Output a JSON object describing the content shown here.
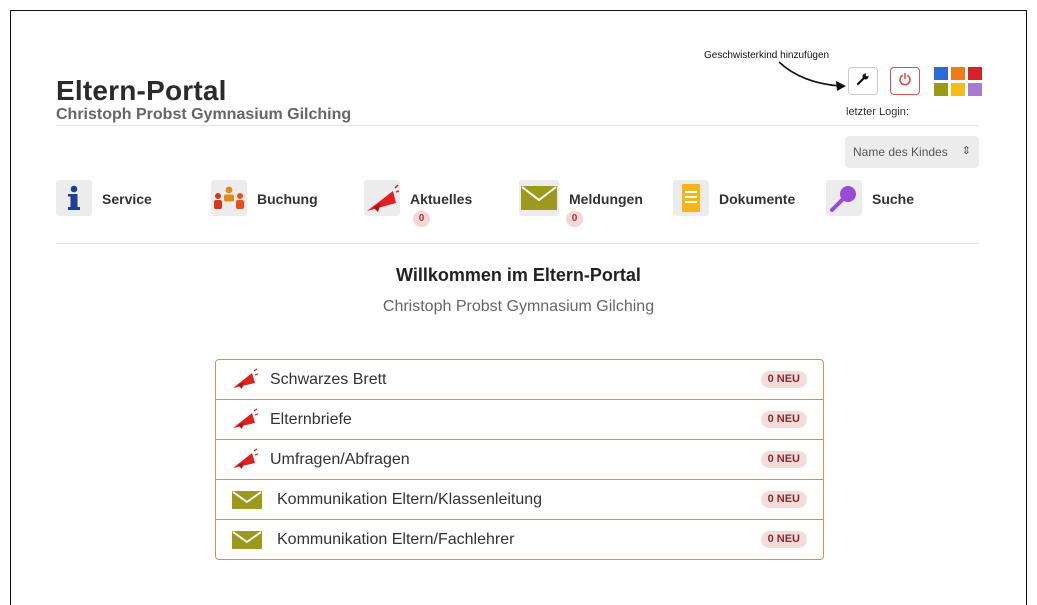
{
  "app": {
    "title": "Eltern-Portal",
    "school": "Christoph Probst Gymnasium Gilching"
  },
  "header": {
    "annotation": "Geschwisterkind hinzufügen",
    "wrench_icon": "wrench-icon",
    "power_icon": "power-icon",
    "last_login_label": "letzter Login:",
    "theme_colors": [
      "#2e6bd6",
      "#f07a1a",
      "#d6222a",
      "#9a9a12",
      "#f3bd14",
      "#a97ad2"
    ]
  },
  "child_select": {
    "value": "Name des Kindes",
    "icon": "chevron-updown-icon"
  },
  "nav": [
    {
      "label": "Service",
      "icon": "info-icon"
    },
    {
      "label": "Buchung",
      "icon": "people-icon"
    },
    {
      "label": "Aktuelles",
      "icon": "megaphone-icon",
      "badge": "0"
    },
    {
      "label": "Meldungen",
      "icon": "envelope-icon",
      "badge": "0"
    },
    {
      "label": "Dokumente",
      "icon": "document-icon"
    },
    {
      "label": "Suche",
      "icon": "search-icon"
    }
  ],
  "welcome": {
    "title": "Willkommen im Eltern-Portal",
    "subtitle": "Christoph Probst Gymnasium Gilching"
  },
  "panel": [
    {
      "label": "Schwarzes Brett",
      "icon": "megaphone-icon",
      "badge": "0 NEU"
    },
    {
      "label": "Elternbriefe",
      "icon": "megaphone-icon",
      "badge": "0 NEU"
    },
    {
      "label": "Umfragen/Abfragen",
      "icon": "megaphone-icon",
      "badge": "0 NEU"
    },
    {
      "label": "Kommunikation Eltern/Klassenleitung",
      "icon": "envelope-icon",
      "badge": "0 NEU"
    },
    {
      "label": "Kommunikation Eltern/Fachlehrer",
      "icon": "envelope-icon",
      "badge": "0 NEU"
    }
  ],
  "colors": {
    "accent_red": "#d9534f",
    "panel_border": "#c9955d",
    "badge_bg": "#f2dcdc",
    "envelope_green": "#9b9a1e"
  }
}
